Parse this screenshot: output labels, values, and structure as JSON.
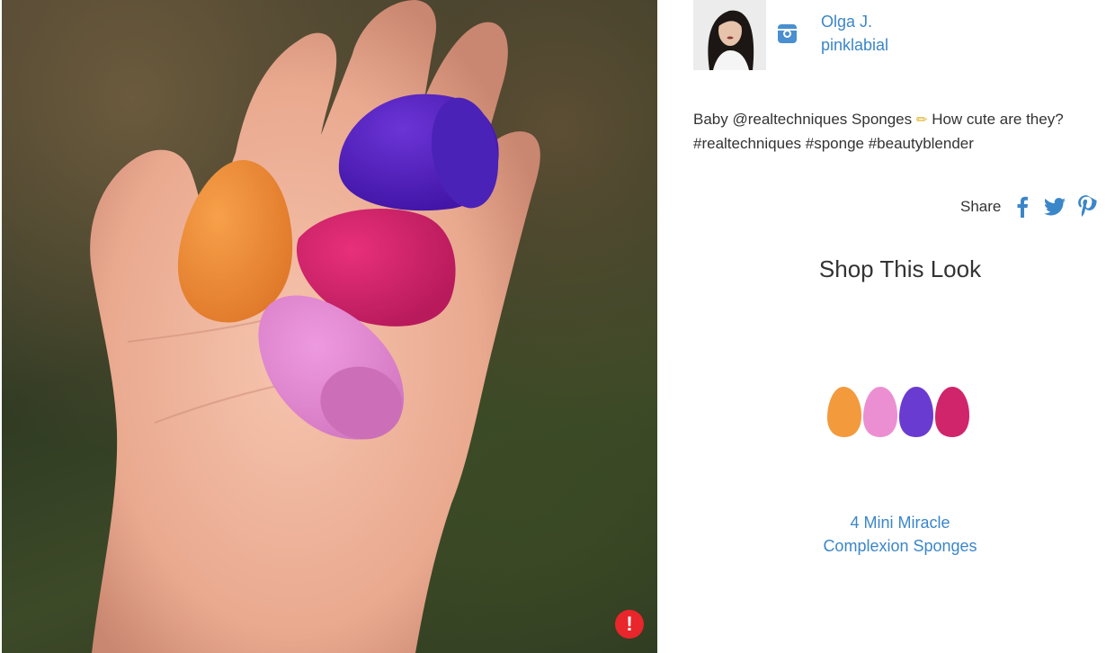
{
  "user": {
    "name": "Olga J.",
    "handle": "pinklabial"
  },
  "post": {
    "caption_part1": "Baby @realtechniques Sponges",
    "caption_part2": "How cute are they? #realtechniques #sponge #beautyblender"
  },
  "share": {
    "label": "Share",
    "icons": [
      "facebook-icon",
      "twitter-icon",
      "pinterest-icon"
    ]
  },
  "shop": {
    "title": "Shop This Look",
    "product_name_line1": "4 Mini Miracle",
    "product_name_line2": "Complexion Sponges"
  },
  "report_button": {
    "glyph": "!"
  },
  "colors": {
    "link": "#3b86c8",
    "report": "#e8262b",
    "sponge_orange": "#f39a3d",
    "sponge_pink": "#ec8fd2",
    "sponge_purple": "#6a3bd0",
    "sponge_magenta": "#d0246b"
  }
}
